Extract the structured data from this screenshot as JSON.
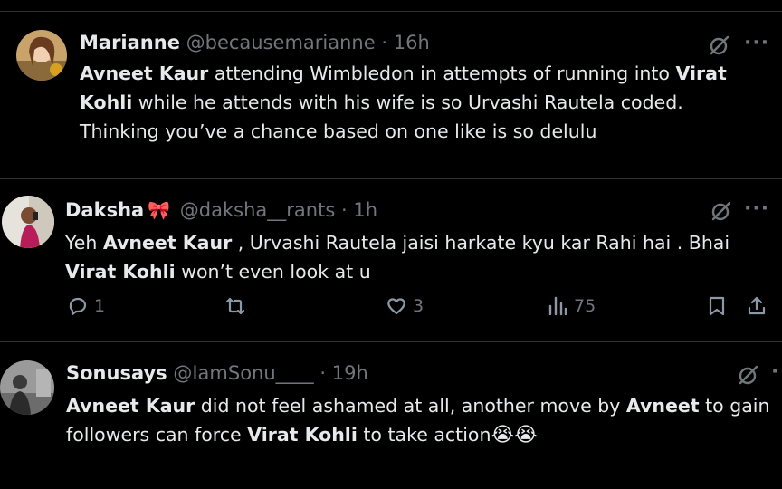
{
  "tweets": [
    {
      "name": "Marianne",
      "handle": "@becausemarianne",
      "dot": "·",
      "time": "16h",
      "text_segments": [
        {
          "t": "Avneet Kaur",
          "b": true
        },
        {
          "t": " attending Wimbledon in attempts of running into ",
          "b": false
        },
        {
          "t": "Virat Kohli",
          "b": true
        },
        {
          "t": " while he attends with his wife is so Urvashi Rautela coded. Thinking you’ve a chance based on one like is so delulu",
          "b": false
        }
      ]
    },
    {
      "name": "Daksha",
      "name_emoji": "🎀",
      "handle": "@daksha__rants",
      "dot": "·",
      "time": "1h",
      "text_segments": [
        {
          "t": "Yeh ",
          "b": false
        },
        {
          "t": "Avneet Kaur",
          "b": true
        },
        {
          "t": " , Urvashi Rautela jaisi harkate kyu kar Rahi hai . Bhai ",
          "b": false
        },
        {
          "t": "Virat Kohli",
          "b": true
        },
        {
          "t": " won’t even look at u",
          "b": false
        }
      ],
      "actions": {
        "replies": "1",
        "reposts": "",
        "likes": "3",
        "views": "75"
      }
    },
    {
      "name": "Sonusays",
      "handle": "@IamSonu____",
      "dot": "·",
      "time": "19h",
      "text_segments": [
        {
          "t": "Avneet Kaur",
          "b": true
        },
        {
          "t": " did not feel ashamed at all, another move by ",
          "b": false
        },
        {
          "t": "Avneet",
          "b": true
        },
        {
          "t": " to gain followers can force ",
          "b": false
        },
        {
          "t": "Virat Kohli",
          "b": true
        },
        {
          "t": " to take action",
          "b": false
        }
      ],
      "trailing_emoji": "😭😭"
    }
  ],
  "icons": {
    "grok": "grok-slash-icon",
    "more": "more-dots-icon",
    "reply": "reply-icon",
    "repost": "repost-icon",
    "like": "heart-icon",
    "views": "views-icon",
    "bookmark": "bookmark-icon",
    "share": "share-icon"
  },
  "colors": {
    "background": "#000000",
    "text": "#e7e9ea",
    "muted": "#71767b",
    "divider": "#2f3336"
  }
}
